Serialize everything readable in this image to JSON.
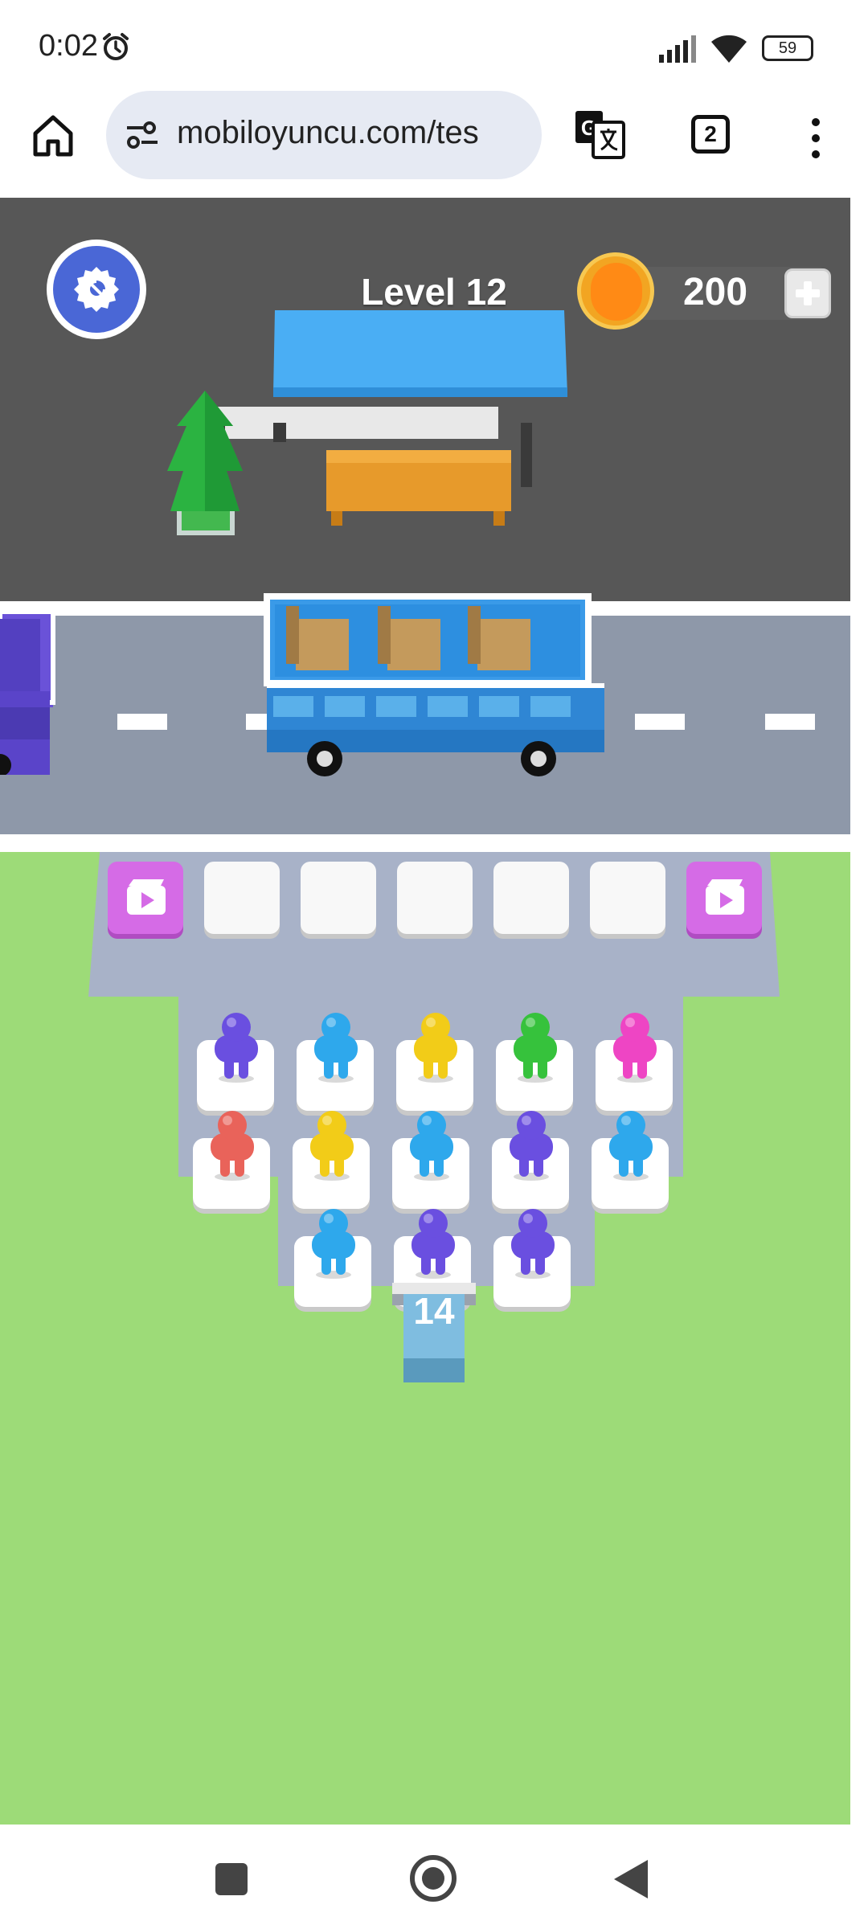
{
  "status_bar": {
    "time": "0:02",
    "battery": "59",
    "icons": [
      "alarm-icon",
      "signal-icon",
      "wifi-icon",
      "battery-icon"
    ]
  },
  "browser": {
    "url": "mobiloyuncu.com/tes",
    "tab_count": "2",
    "icons": [
      "home-icon",
      "site-settings-icon",
      "translate-icon",
      "tabs-icon",
      "more-menu-icon"
    ]
  },
  "hud": {
    "level_label": "Level 12",
    "coins": "200",
    "settings_icon": "gear-icon",
    "plus_icon": "plus-icon"
  },
  "board": {
    "waiting_slots_empty": 5,
    "ad_slot_icon": "video-ad-icon",
    "rows": [
      [
        "purple",
        "blue",
        "yellow",
        "green",
        "pink"
      ],
      [
        "red",
        "yellow",
        "blue",
        "purple",
        "blue"
      ],
      [
        "blue",
        "purple",
        "purple"
      ]
    ],
    "queue_count": "14"
  },
  "colors": {
    "purple": "#6a4fe0",
    "blue": "#2ea8ec",
    "yellow": "#f2cc18",
    "green": "#36c23c",
    "pink": "#ee45c4",
    "red": "#e9635a",
    "bus": "#2d8fe0",
    "grass": "#9ddb78",
    "ad_button": "#d56be6"
  },
  "navbar": {
    "icons": [
      "recents-icon",
      "home-circle-icon",
      "back-icon"
    ]
  }
}
